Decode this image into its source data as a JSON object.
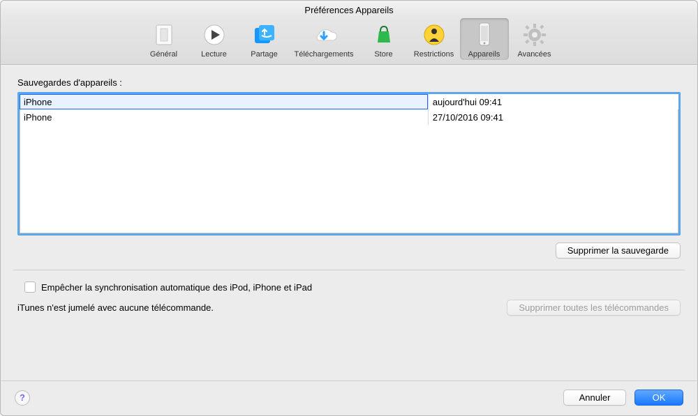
{
  "window": {
    "title": "Préférences Appareils"
  },
  "toolbar": {
    "tabs": [
      {
        "id": "general",
        "label": "Général"
      },
      {
        "id": "playback",
        "label": "Lecture"
      },
      {
        "id": "sharing",
        "label": "Partage"
      },
      {
        "id": "downloads",
        "label": "Téléchargements"
      },
      {
        "id": "store",
        "label": "Store"
      },
      {
        "id": "restrictions",
        "label": "Restrictions"
      },
      {
        "id": "devices",
        "label": "Appareils",
        "selected": true
      },
      {
        "id": "advanced",
        "label": "Avancées"
      }
    ]
  },
  "backups": {
    "heading": "Sauvegardes d'appareils :",
    "rows": [
      {
        "name": "iPhone",
        "date": "aujourd'hui 09:41",
        "selected": true
      },
      {
        "name": "iPhone",
        "date": "27/10/2016 09:41"
      }
    ],
    "delete_label": "Supprimer la sauvegarde"
  },
  "sync": {
    "prevent_label": "Empêcher la synchronisation automatique des iPod, iPhone et iPad",
    "prevent_checked": false
  },
  "remote": {
    "status": "iTunes n'est jumelé avec aucune télécommande.",
    "delete_all_label": "Supprimer toutes les télécommandes",
    "delete_all_enabled": false
  },
  "footer": {
    "help_symbol": "?",
    "cancel": "Annuler",
    "ok": "OK"
  },
  "colors": {
    "accent": "#1a78ff",
    "focus_ring": "#5ea7ec"
  }
}
